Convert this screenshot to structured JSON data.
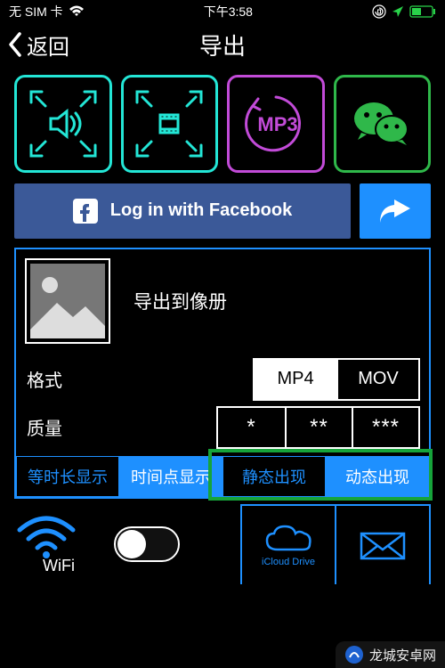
{
  "status": {
    "sim": "无 SIM 卡",
    "time": "下午3:58"
  },
  "nav": {
    "back": "返回",
    "title": "导出"
  },
  "formats": {
    "mp3": "MP3"
  },
  "fb": {
    "label": "Log in with Facebook"
  },
  "panel": {
    "album_label": "导出到像册",
    "format_label": "格式",
    "format_opts": [
      "MP4",
      "MOV"
    ],
    "quality_label": "质量",
    "quality_opts": [
      "*",
      "**",
      "***"
    ],
    "display": [
      "等时长显示",
      "时间点显示"
    ],
    "appear": [
      "静态出现",
      "动态出现"
    ]
  },
  "bottom": {
    "wifi": "WiFi",
    "icloud": "iCloud Drive"
  },
  "watermark": "龙城安卓网"
}
